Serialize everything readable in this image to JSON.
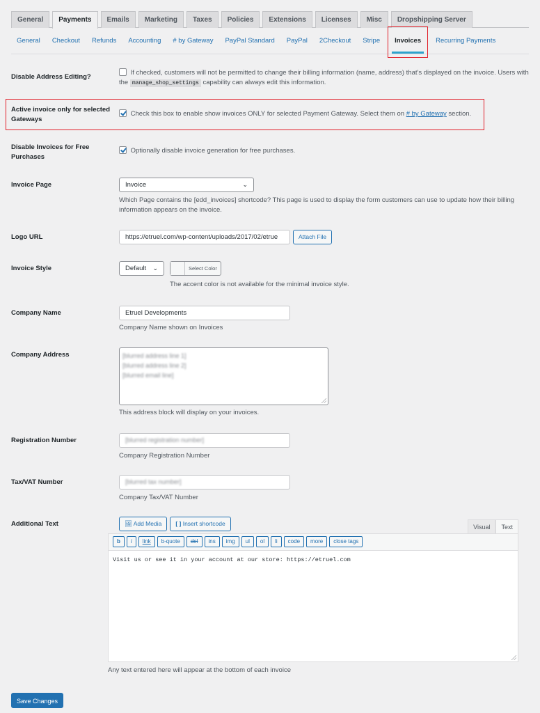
{
  "main_tabs": [
    "General",
    "Payments",
    "Emails",
    "Marketing",
    "Taxes",
    "Policies",
    "Extensions",
    "Licenses",
    "Misc",
    "Dropshipping Server"
  ],
  "main_tab_active": "Payments",
  "sub_tabs": [
    "General",
    "Checkout",
    "Refunds",
    "Accounting",
    "# by Gateway",
    "PayPal Standard",
    "PayPal",
    "2Checkout",
    "Stripe",
    "Invoices",
    "Recurring Payments"
  ],
  "sub_tab_active": "Invoices",
  "settings": {
    "disable_address": {
      "label": "Disable Address Editing?",
      "checked": false,
      "desc_before": "If checked, customers will not be permitted to change their billing information (name, address) that's displayed on the invoice. Users with the",
      "code": "manage_shop_settings",
      "desc_after": "capability can always edit this information."
    },
    "active_invoice": {
      "label": "Active invoice only for selected Gateways",
      "checked": true,
      "desc_before": "Check this box to enable show invoices ONLY for selected Payment Gateway. Select them on",
      "link": "# by Gateway",
      "desc_after": "section."
    },
    "disable_free": {
      "label": "Disable Invoices for Free Purchases",
      "checked": true,
      "desc": "Optionally disable invoice generation for free purchases."
    },
    "invoice_page": {
      "label": "Invoice Page",
      "value": "Invoice",
      "desc": "Which Page contains the [edd_invoices] shortcode? This page is used to display the form customers can use to update how their billing information appears on the invoice."
    },
    "logo_url": {
      "label": "Logo URL",
      "value": "https://etruel.com/wp-content/uploads/2017/02/etrue",
      "button": "Attach File"
    },
    "invoice_style": {
      "label": "Invoice Style",
      "value": "Default",
      "color_button": "Select Color",
      "desc": "The accent color is not available for the minimal invoice style."
    },
    "company_name": {
      "label": "Company Name",
      "value": "Etruel Developments",
      "desc": "Company Name shown on Invoices"
    },
    "company_address": {
      "label": "Company Address",
      "lines": [
        "[blurred address line 1]",
        "[blurred address line 2]",
        "[blurred email line]"
      ],
      "desc": "This address block will display on your invoices."
    },
    "registration": {
      "label": "Registration Number",
      "value": "[blurred registration number]",
      "desc": "Company Registration Number"
    },
    "tax_vat": {
      "label": "Tax/VAT Number",
      "value": "[blurred tax number]",
      "desc": "Company Tax/VAT Number"
    },
    "additional_text": {
      "label": "Additional Text",
      "add_media": "Add Media",
      "insert_shortcode": "Insert shortcode",
      "tab_visual": "Visual",
      "tab_text": "Text",
      "quicktags": [
        "b",
        "i",
        "link",
        "b-quote",
        "del",
        "ins",
        "img",
        "ul",
        "ol",
        "li",
        "code",
        "more",
        "close tags"
      ],
      "content": "Visit us or see it in your account at our store: https://etruel.com",
      "desc": "Any text entered here will appear at the bottom of each invoice"
    }
  },
  "save_button": "Save Changes"
}
